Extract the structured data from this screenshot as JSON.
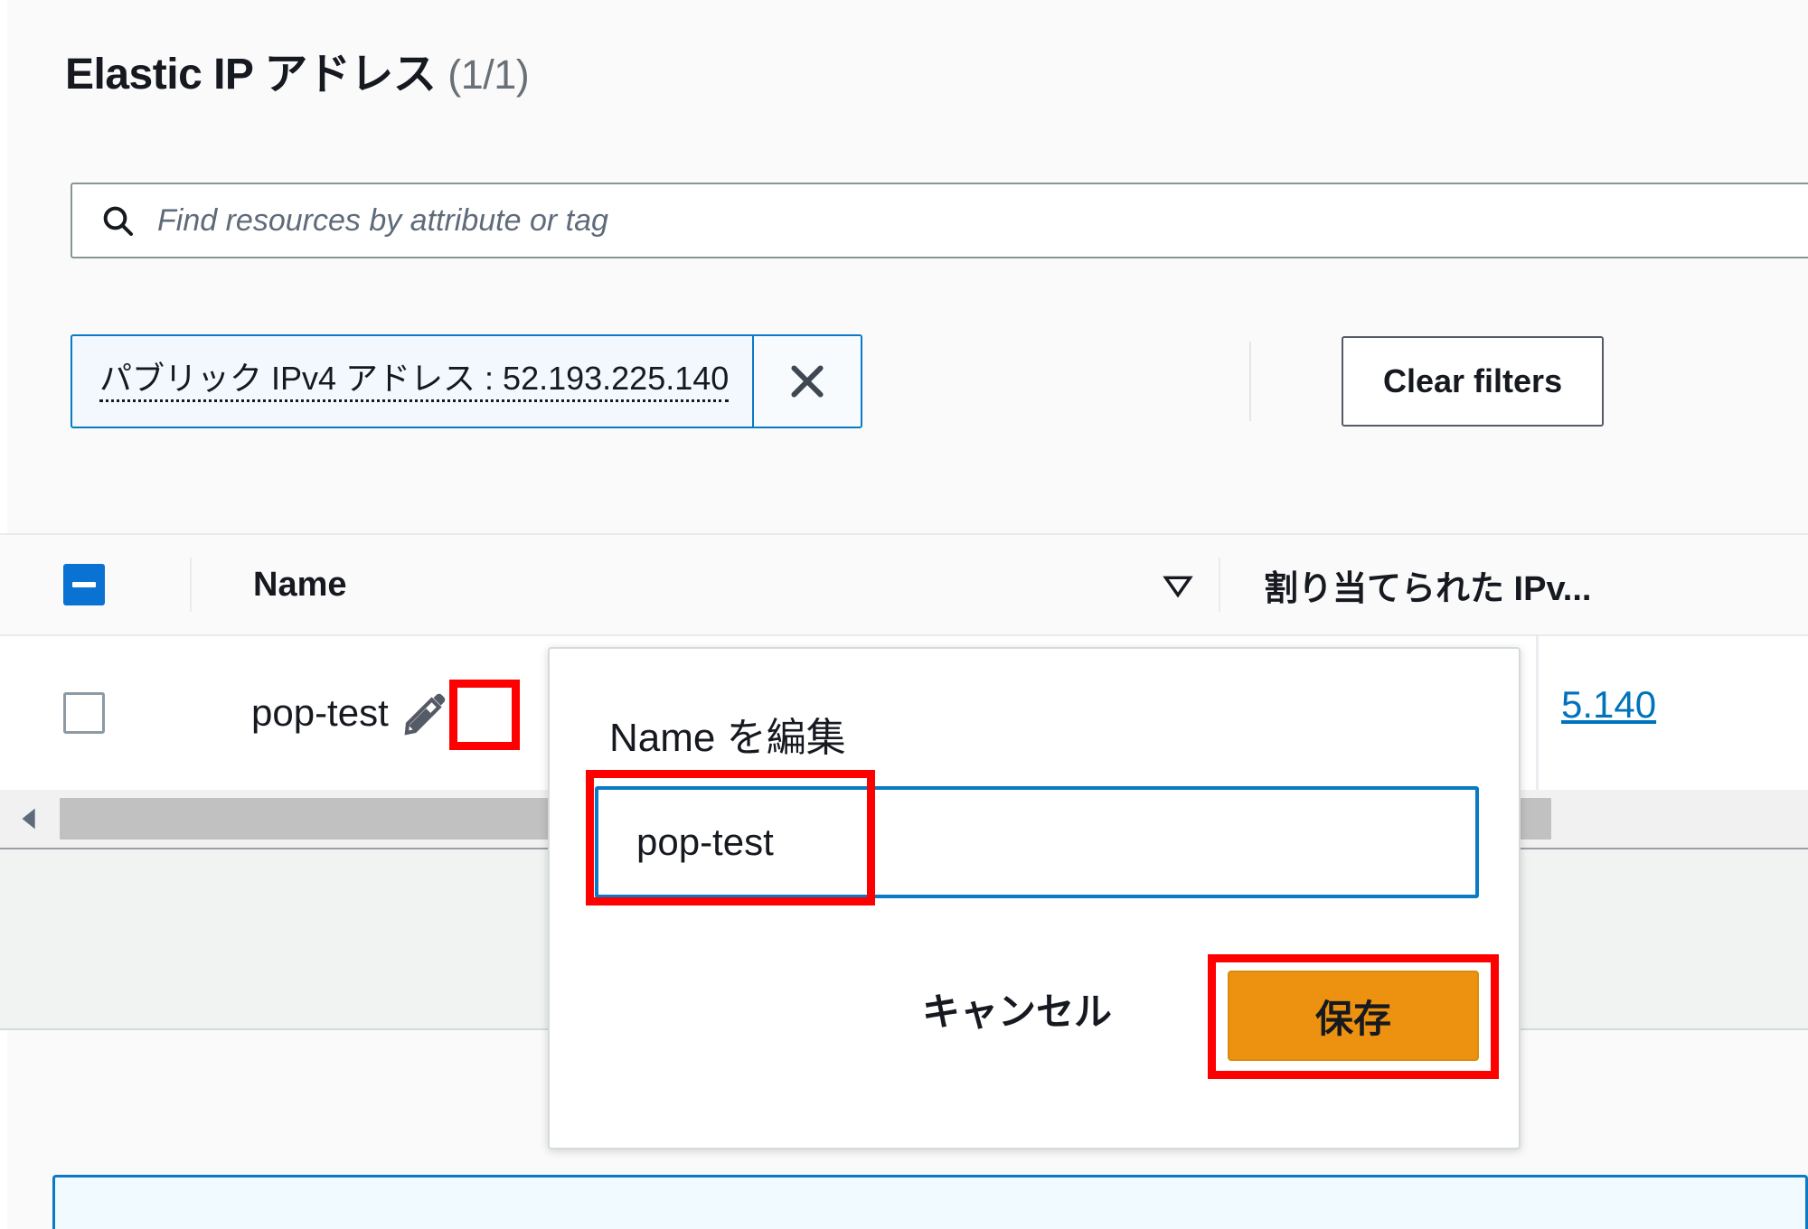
{
  "page": {
    "title_main": "Elastic IP アドレス",
    "title_count": "(1/1)"
  },
  "search": {
    "placeholder": "Find resources by attribute or tag",
    "value": "",
    "icon": "search-icon"
  },
  "filters": {
    "token_label": "パブリック IPv4 アドレス : 52.193.225.140",
    "dismiss_icon": "close-icon",
    "clear_button": "Clear filters"
  },
  "table": {
    "select_all_state": "indeterminate",
    "columns": [
      {
        "key": "name",
        "label": "Name",
        "sort_icon": "sort-descending-icon"
      },
      {
        "key": "ipv4",
        "label": "割り当てられた IPv..."
      }
    ],
    "rows": [
      {
        "selected": false,
        "name": "pop-test",
        "edit_icon": "pencil-icon",
        "ipv4": "5.140"
      }
    ]
  },
  "scrollbar": {
    "left_arrow_icon": "chevron-left-icon",
    "orientation": "horizontal"
  },
  "popover": {
    "title": "Name を編集",
    "input_value": "pop-test",
    "input_placeholder": "",
    "cancel_label": "キャンセル",
    "save_label": "保存"
  },
  "colors": {
    "accent_blue": "#0a7ac4",
    "link_blue": "#0073bb",
    "save_orange": "#ec9210",
    "annotation_red": "#ff0000",
    "checkbox_blue": "#0972d3",
    "text_dark": "#16191f",
    "text_muted": "#687078"
  },
  "annotations": [
    {
      "name": "pencil-icon-highlight",
      "target": "row-edit-pencil"
    },
    {
      "name": "name-input-highlight",
      "target": "popover-name-input"
    },
    {
      "name": "save-button-highlight",
      "target": "popover-save-button"
    }
  ]
}
